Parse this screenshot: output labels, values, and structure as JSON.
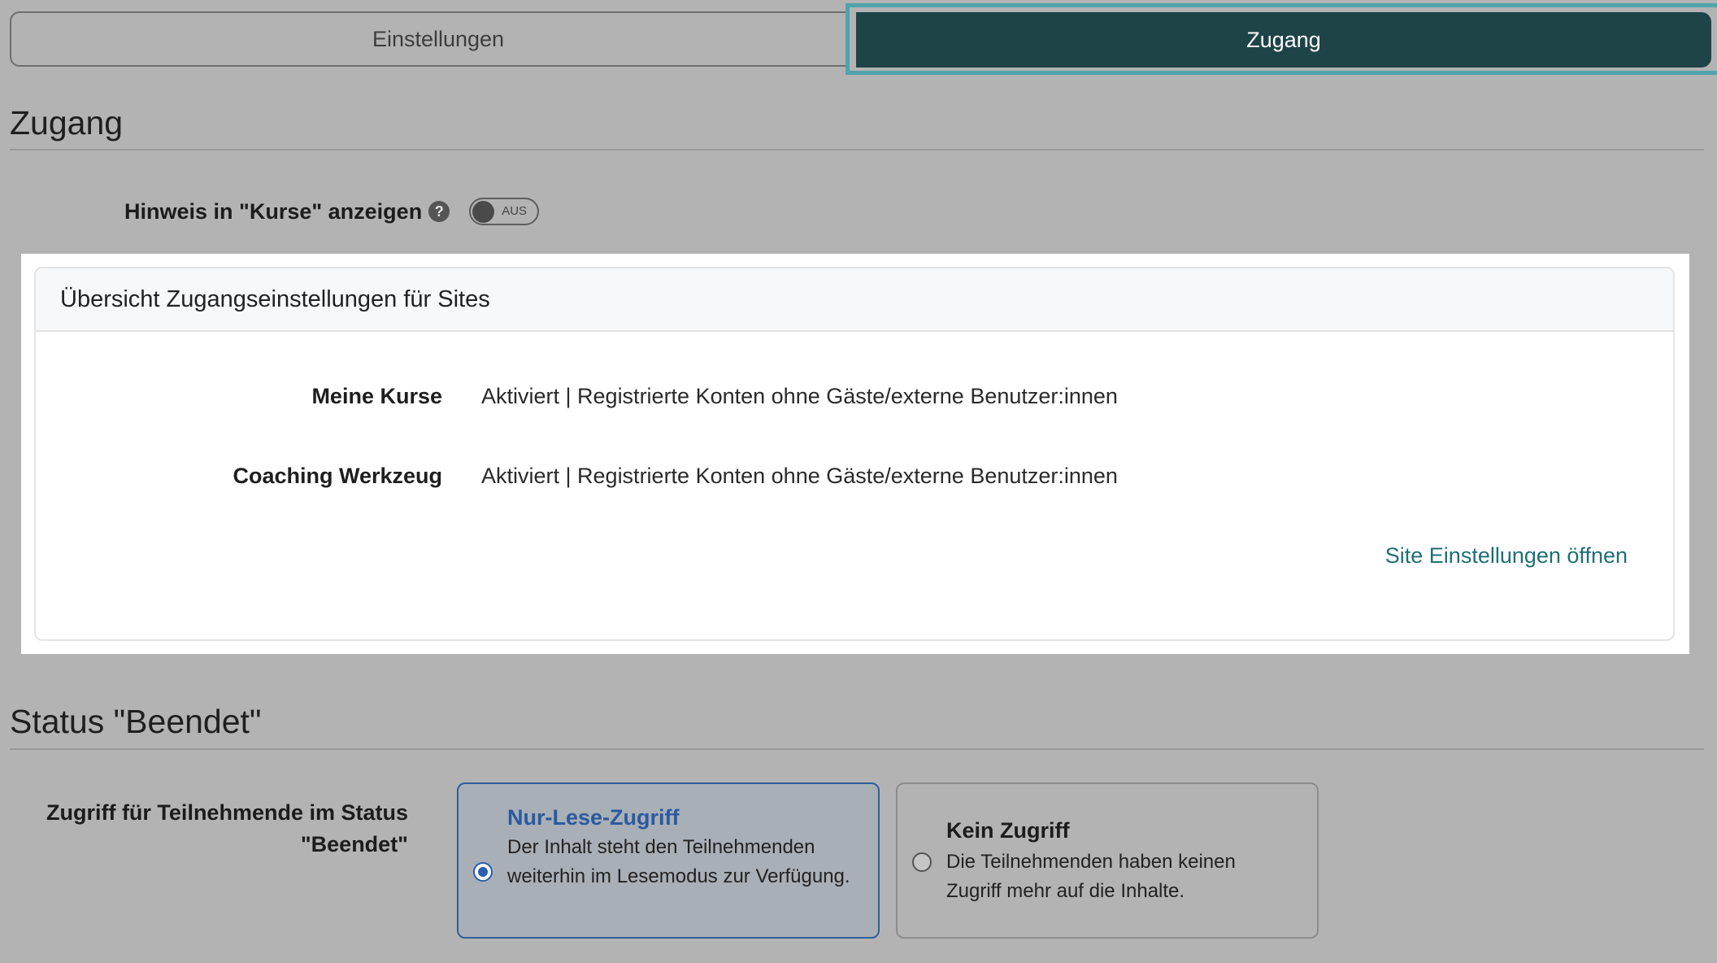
{
  "tabs": [
    {
      "label": "Einstellungen",
      "active": false
    },
    {
      "label": "Zugang",
      "active": true
    }
  ],
  "access_section": {
    "title": "Zugang",
    "toggle_label": "Hinweis in \"Kurse\" anzeigen",
    "help_icon": "?",
    "toggle_state": "AUS"
  },
  "overview_card": {
    "title": "Übersicht Zugangseinstellungen für Sites",
    "rows": [
      {
        "label": "Meine Kurse",
        "value": "Aktiviert | Registrierte Konten ohne Gäste/externe Benutzer:innen"
      },
      {
        "label": "Coaching Werkzeug",
        "value": "Aktiviert | Registrierte Konten ohne Gäste/externe Benutzer:innen"
      }
    ],
    "link": "Site Einstellungen öffnen"
  },
  "status_section": {
    "title": "Status \"Beendet\"",
    "field_label_line1": "Zugriff für Teilnehmende im Status",
    "field_label_line2": "\"Beendet\"",
    "options": [
      {
        "title": "Nur-Lese-Zugriff",
        "description": "Der Inhalt steht den Teilnehmenden weiterhin im Lesemodus zur Verfügung.",
        "selected": true
      },
      {
        "title": "Kein Zugriff",
        "description": "Die Teilnehmenden haben keinen Zugriff mehr auf die Inhalte.",
        "selected": false
      }
    ]
  },
  "colors": {
    "active_tab_bg": "#1e4448",
    "highlight_border": "#4fa3ad",
    "link": "#1f6f76",
    "selected_option_border": "#2f5f9a"
  }
}
